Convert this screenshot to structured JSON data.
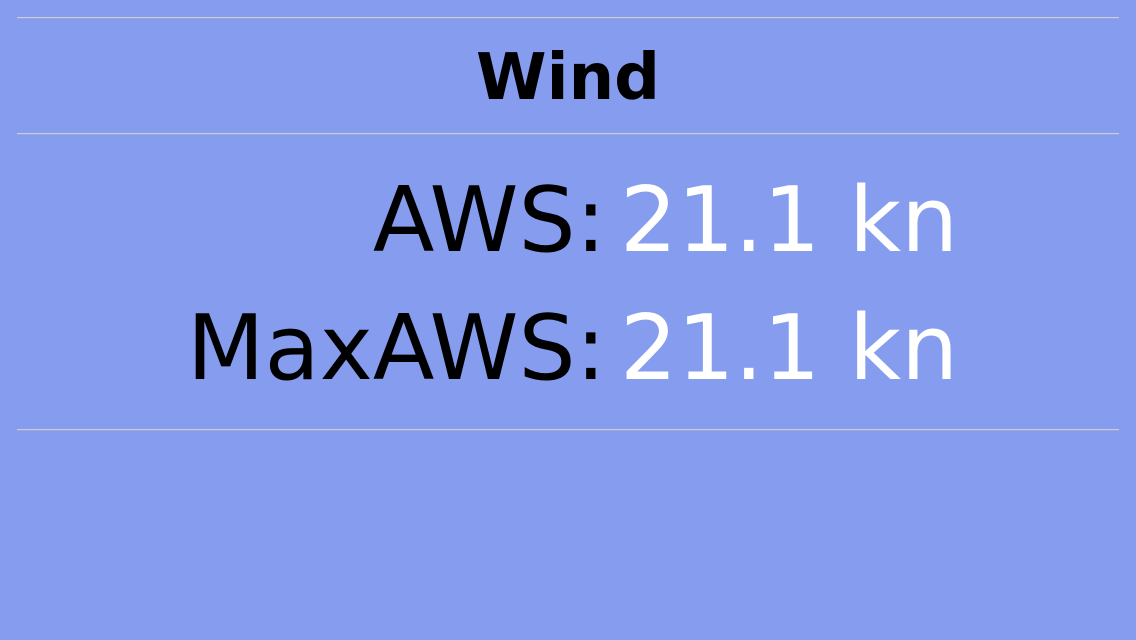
{
  "panel": {
    "title": "Wind"
  },
  "readings": [
    {
      "label": "AWS:",
      "value": "21.1 kn"
    },
    {
      "label": "MaxAWS:",
      "value": "21.1 kn"
    }
  ],
  "colors": {
    "background": "#869cee",
    "label": "#000000",
    "value": "#ffffff",
    "divider": "#c8cde0"
  }
}
